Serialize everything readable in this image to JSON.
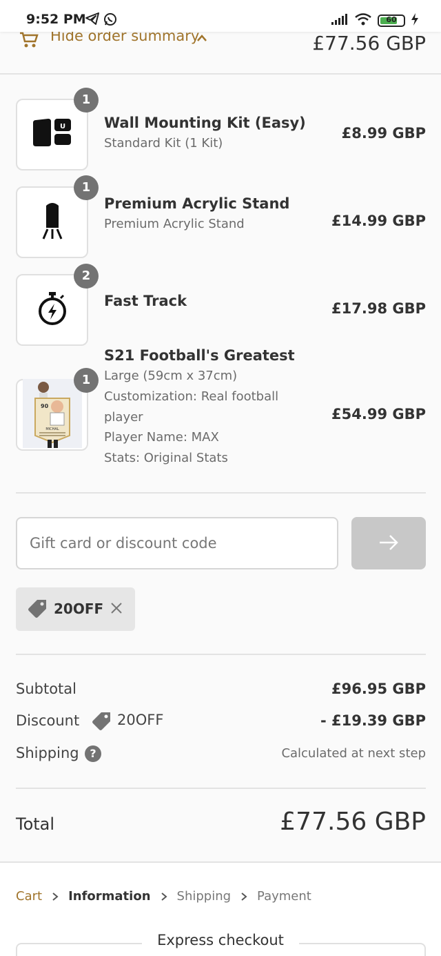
{
  "status_bar": {
    "time": "9:52 PM",
    "battery": "60"
  },
  "summary_toggle": {
    "label": "Hide order summary",
    "total": "£77.56 GBP"
  },
  "items": [
    {
      "qty": "1",
      "title": "Wall Mounting Kit (Easy)",
      "sub": [
        "Standard Kit (1 Kit)"
      ],
      "price": "£8.99 GBP",
      "icon": "wall-mount-kit-icon"
    },
    {
      "qty": "1",
      "title": "Premium Acrylic Stand",
      "sub": [
        "Premium Acrylic Stand"
      ],
      "price": "£14.99 GBP",
      "icon": "acrylic-stand-icon"
    },
    {
      "qty": "2",
      "title": "Fast Track",
      "sub": [],
      "price": "£17.98 GBP",
      "icon": "stopwatch-icon"
    },
    {
      "qty": "1",
      "title": "S21 Football's Greatest",
      "sub": [
        "Large (59cm x 37cm)",
        "Customization: Real football",
        "player",
        "Player Name: MAX",
        "Stats: Original Stats"
      ],
      "price": "£54.99 GBP",
      "icon": "player-card-image",
      "card_text": {
        "rating": "90",
        "name": "MICHAL"
      }
    }
  ],
  "discount": {
    "placeholder": "Gift card or discount code",
    "applied_code": "20OFF"
  },
  "totals": {
    "subtotal_label": "Subtotal",
    "subtotal_value": "£96.95 GBP",
    "discount_label": "Discount",
    "discount_code": "20OFF",
    "discount_value": "- £19.39 GBP",
    "shipping_label": "Shipping",
    "shipping_value": "Calculated at next step",
    "total_label": "Total",
    "total_value": "£77.56 GBP"
  },
  "breadcrumb": [
    "Cart",
    "Information",
    "Shipping",
    "Payment"
  ],
  "express_checkout": "Express checkout",
  "colors": {
    "accent": "#a0742b",
    "badge": "#737373",
    "button_disabled": "#c8c8c8"
  }
}
